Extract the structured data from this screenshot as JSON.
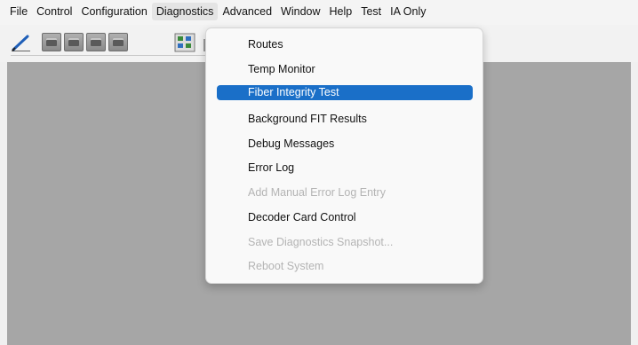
{
  "menubar": {
    "items": [
      {
        "label": "File"
      },
      {
        "label": "Control"
      },
      {
        "label": "Configuration"
      },
      {
        "label": "Diagnostics"
      },
      {
        "label": "Advanced"
      },
      {
        "label": "Window"
      },
      {
        "label": "Help"
      },
      {
        "label": "Test"
      },
      {
        "label": "IA Only"
      }
    ],
    "active_item": "Diagnostics"
  },
  "toolbar": {
    "icons": [
      "pencil-icon",
      "device-icon",
      "device-icon",
      "device-icon",
      "device-icon",
      "network-grid-icon",
      "partial-icon"
    ]
  },
  "diagnostics_menu": {
    "items": [
      {
        "label": "Routes",
        "state": "enabled"
      },
      {
        "label": "Temp Monitor",
        "state": "enabled"
      },
      {
        "label": "Fiber Integrity Test",
        "state": "selected"
      },
      {
        "label": "Background FIT Results",
        "state": "enabled"
      },
      {
        "label": "Debug Messages",
        "state": "enabled"
      },
      {
        "label": "Error Log",
        "state": "enabled"
      },
      {
        "label": "Add Manual Error Log Entry",
        "state": "disabled"
      },
      {
        "label": "Decoder Card Control",
        "state": "enabled"
      },
      {
        "label": "Save Diagnostics Snapshot...",
        "state": "disabled"
      },
      {
        "label": "Reboot System",
        "state": "disabled"
      }
    ]
  },
  "colors": {
    "highlight": "#1a6fc8",
    "workspace": "#a6a6a6",
    "disabled_text": "#b4b4b4"
  }
}
